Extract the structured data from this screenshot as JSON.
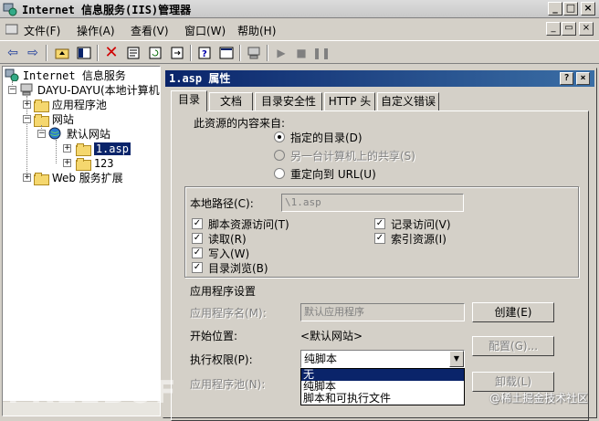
{
  "window": {
    "title": "Internet 信息服务(IIS)管理器",
    "min": "_",
    "max": "□",
    "close": "×"
  },
  "menu": {
    "items": [
      "文件(F)",
      "操作(A)",
      "查看(V)",
      "窗口(W)",
      "帮助(H)"
    ],
    "mdi_buttons": [
      "_",
      "▭",
      "×"
    ]
  },
  "tree": {
    "root": "Internet 信息服务",
    "server": "DAYU-DAYU(本地计算机)",
    "app_pools": "应用程序池",
    "websites": "网站",
    "default_site": "默认网站",
    "file": "1.asp",
    "folder_123": "123",
    "web_ext": "Web 服务扩展"
  },
  "dialog": {
    "title": "1.asp 属性",
    "help": "?",
    "close": "×",
    "tabs": [
      "目录",
      "文档",
      "目录安全性",
      "HTTP 头",
      "自定义错误"
    ],
    "content_source_label": "此资源的内容来自:",
    "radios": [
      {
        "label": "指定的目录(D)",
        "checked": true,
        "disabled": false
      },
      {
        "label": "另一台计算机上的共享(S)",
        "checked": false,
        "disabled": true
      },
      {
        "label": "重定向到 URL(U)",
        "checked": false,
        "disabled": false
      }
    ],
    "local_path_label": "本地路径(C):",
    "local_path_value": "\\1.asp",
    "checkboxes_left": [
      {
        "label": "脚本资源访问(T)",
        "checked": true
      },
      {
        "label": "读取(R)",
        "checked": true
      },
      {
        "label": "写入(W)",
        "checked": true
      },
      {
        "label": "目录浏览(B)",
        "checked": true
      }
    ],
    "checkboxes_right": [
      {
        "label": "记录访问(V)",
        "checked": true
      },
      {
        "label": "索引资源(I)",
        "checked": true
      }
    ],
    "app_settings_label": "应用程序设置",
    "app_name_label": "应用程序名(M):",
    "app_name_value": "默认应用程序",
    "create_button": "创建(E)",
    "start_point_label": "开始位置:",
    "start_point_value": "<默认网站>",
    "config_button": "配置(G)...",
    "exec_perm_label": "执行权限(P):",
    "exec_perm_value": "纯脚本",
    "app_pool_label": "应用程序池(N):",
    "unload_button": "卸载(L)",
    "dropdown_options": [
      "无",
      "纯脚本",
      "脚本和可执行文件"
    ],
    "dropdown_highlight": 0
  },
  "watermark": "@稀土掘金技术社区",
  "watermark_logo": "FREEBUF"
}
